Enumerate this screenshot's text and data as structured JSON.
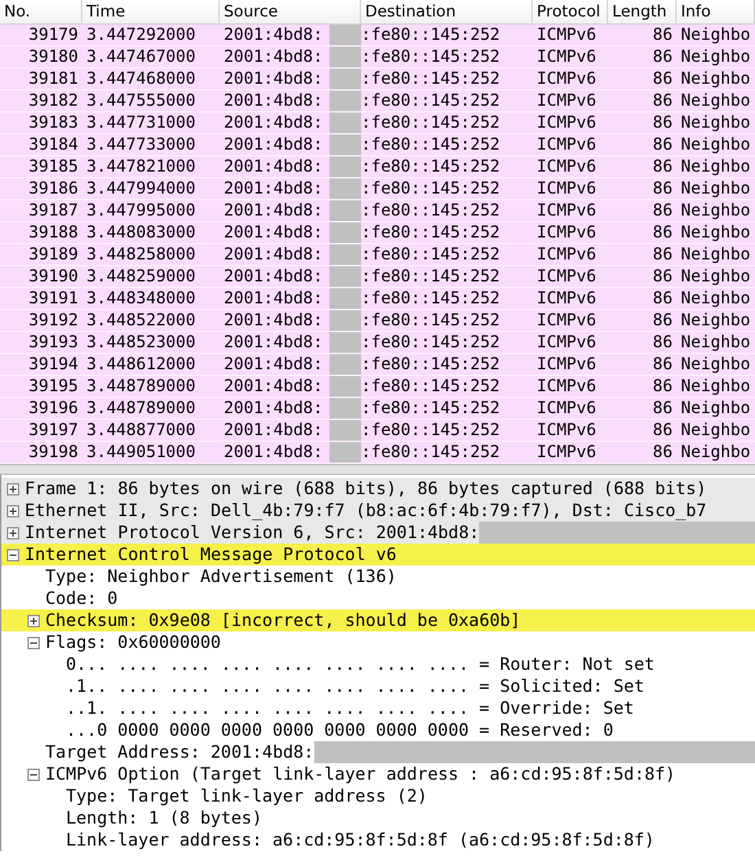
{
  "packet_list": {
    "columns": [
      "No.",
      "Time",
      "Source",
      "Destination",
      "Protocol",
      "Length",
      "Info"
    ],
    "rows": [
      {
        "no": "39179",
        "time": "3.447292000",
        "source": "2001:4bd8:",
        "destination": ":fe80::145:252",
        "protocol": "ICMPv6",
        "length": "86",
        "info": "Neighbo"
      },
      {
        "no": "39180",
        "time": "3.447467000",
        "source": "2001:4bd8:",
        "destination": ":fe80::145:252",
        "protocol": "ICMPv6",
        "length": "86",
        "info": "Neighbo"
      },
      {
        "no": "39181",
        "time": "3.447468000",
        "source": "2001:4bd8:",
        "destination": ":fe80::145:252",
        "protocol": "ICMPv6",
        "length": "86",
        "info": "Neighbo"
      },
      {
        "no": "39182",
        "time": "3.447555000",
        "source": "2001:4bd8:",
        "destination": ":fe80::145:252",
        "protocol": "ICMPv6",
        "length": "86",
        "info": "Neighbo"
      },
      {
        "no": "39183",
        "time": "3.447731000",
        "source": "2001:4bd8:",
        "destination": ":fe80::145:252",
        "protocol": "ICMPv6",
        "length": "86",
        "info": "Neighbo"
      },
      {
        "no": "39184",
        "time": "3.447733000",
        "source": "2001:4bd8:",
        "destination": ":fe80::145:252",
        "protocol": "ICMPv6",
        "length": "86",
        "info": "Neighbo"
      },
      {
        "no": "39185",
        "time": "3.447821000",
        "source": "2001:4bd8:",
        "destination": ":fe80::145:252",
        "protocol": "ICMPv6",
        "length": "86",
        "info": "Neighbo"
      },
      {
        "no": "39186",
        "time": "3.447994000",
        "source": "2001:4bd8:",
        "destination": ":fe80::145:252",
        "protocol": "ICMPv6",
        "length": "86",
        "info": "Neighbo"
      },
      {
        "no": "39187",
        "time": "3.447995000",
        "source": "2001:4bd8:",
        "destination": ":fe80::145:252",
        "protocol": "ICMPv6",
        "length": "86",
        "info": "Neighbo"
      },
      {
        "no": "39188",
        "time": "3.448083000",
        "source": "2001:4bd8:",
        "destination": ":fe80::145:252",
        "protocol": "ICMPv6",
        "length": "86",
        "info": "Neighbo"
      },
      {
        "no": "39189",
        "time": "3.448258000",
        "source": "2001:4bd8:",
        "destination": ":fe80::145:252",
        "protocol": "ICMPv6",
        "length": "86",
        "info": "Neighbo"
      },
      {
        "no": "39190",
        "time": "3.448259000",
        "source": "2001:4bd8:",
        "destination": ":fe80::145:252",
        "protocol": "ICMPv6",
        "length": "86",
        "info": "Neighbo"
      },
      {
        "no": "39191",
        "time": "3.448348000",
        "source": "2001:4bd8:",
        "destination": ":fe80::145:252",
        "protocol": "ICMPv6",
        "length": "86",
        "info": "Neighbo"
      },
      {
        "no": "39192",
        "time": "3.448522000",
        "source": "2001:4bd8:",
        "destination": ":fe80::145:252",
        "protocol": "ICMPv6",
        "length": "86",
        "info": "Neighbo"
      },
      {
        "no": "39193",
        "time": "3.448523000",
        "source": "2001:4bd8:",
        "destination": ":fe80::145:252",
        "protocol": "ICMPv6",
        "length": "86",
        "info": "Neighbo"
      },
      {
        "no": "39194",
        "time": "3.448612000",
        "source": "2001:4bd8:",
        "destination": ":fe80::145:252",
        "protocol": "ICMPv6",
        "length": "86",
        "info": "Neighbo"
      },
      {
        "no": "39195",
        "time": "3.448789000",
        "source": "2001:4bd8:",
        "destination": ":fe80::145:252",
        "protocol": "ICMPv6",
        "length": "86",
        "info": "Neighbo"
      },
      {
        "no": "39196",
        "time": "3.448789000",
        "source": "2001:4bd8:",
        "destination": ":fe80::145:252",
        "protocol": "ICMPv6",
        "length": "86",
        "info": "Neighbo"
      },
      {
        "no": "39197",
        "time": "3.448877000",
        "source": "2001:4bd8:",
        "destination": ":fe80::145:252",
        "protocol": "ICMPv6",
        "length": "86",
        "info": "Neighbo"
      },
      {
        "no": "39198",
        "time": "3.449051000",
        "source": "2001:4bd8:",
        "destination": ":fe80::145:252",
        "protocol": "ICMPv6",
        "length": "86",
        "info": "Neighbo"
      }
    ]
  },
  "details": [
    {
      "text": "Frame 1: 86 bytes on wire (688 bits), 86 bytes captured (688 bits)",
      "expanded": false,
      "color": "#e8e8e8"
    },
    {
      "text": "Ethernet II, Src: Dell_4b:79:f7 (b8:ac:6f:4b:79:f7), Dst: Cisco_b7",
      "expanded": false,
      "color": "#e8e8e8"
    },
    {
      "text": "Internet Protocol Version 6, Src: 2001:4bd8:",
      "expanded": false,
      "color": "#e8e8e8",
      "redacted": true
    },
    {
      "text": "Internet Control Message Protocol v6",
      "expanded": true,
      "color": "#f5f04a",
      "children": [
        {
          "text": "Type: Neighbor Advertisement (136)"
        },
        {
          "text": "Code: 0"
        },
        {
          "text": "Checksum: 0x9e08 [incorrect, should be 0xa60b]",
          "expanded": false,
          "color": "#f5f04a"
        },
        {
          "text": "Flags: 0x60000000",
          "expanded": true,
          "children": [
            {
              "text": "0... .... .... .... .... .... .... .... = Router: Not set"
            },
            {
              "text": ".1.. .... .... .... .... .... .... .... = Solicited: Set"
            },
            {
              "text": "..1. .... .... .... .... .... .... .... = Override: Set"
            },
            {
              "text": "...0 0000 0000 0000 0000 0000 0000 0000 = Reserved: 0"
            }
          ]
        },
        {
          "text": "Target Address: 2001:4bd8:",
          "redacted": true
        },
        {
          "text": "ICMPv6 Option (Target link-layer address : a6:cd:95:8f:5d:8f)",
          "expanded": true,
          "children": [
            {
              "text": "Type: Target link-layer address (2)"
            },
            {
              "text": "Length: 1 (8 bytes)"
            },
            {
              "text": "Link-layer address: a6:cd:95:8f:5d:8f (a6:cd:95:8f:5d:8f)"
            }
          ]
        }
      ]
    }
  ]
}
